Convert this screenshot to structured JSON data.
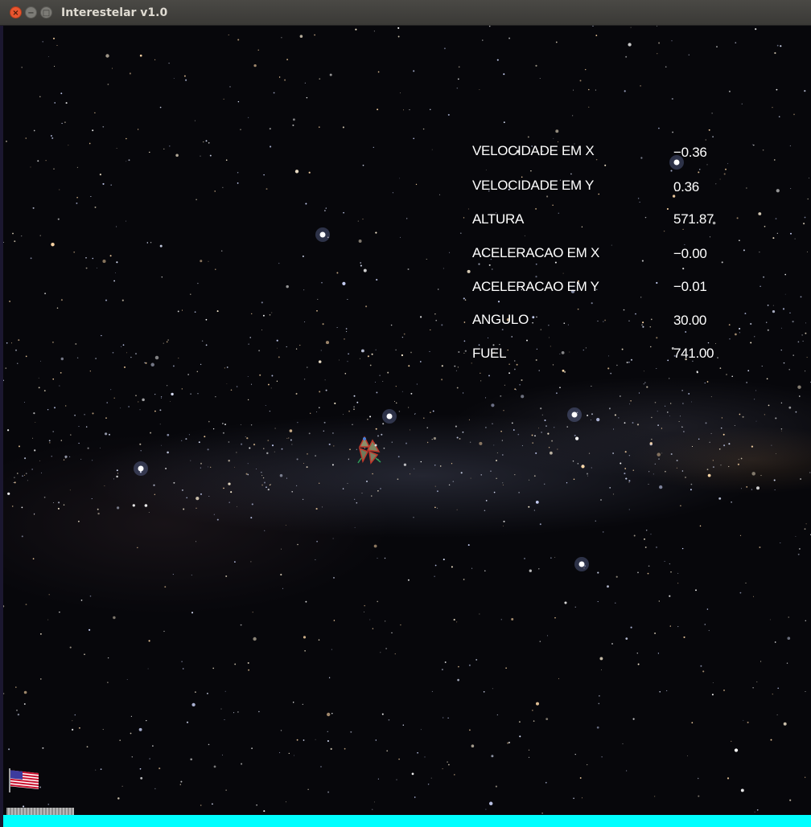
{
  "window": {
    "title": "Interestelar v1.0",
    "close_glyph": "×",
    "min_glyph": "−",
    "max_glyph": "□"
  },
  "hud": [
    {
      "label": "VELOCIDADE EM X",
      "value": "−0.36"
    },
    {
      "label": "VELOCIDADE EM Y",
      "value": "0.36"
    },
    {
      "label": "ALTURA",
      "value": "571.87"
    },
    {
      "label": "ACELERACAO EM X",
      "value": "−0.00"
    },
    {
      "label": "ACELERACAO EM Y",
      "value": "−0.01"
    },
    {
      "label": "ANGULO",
      "value": "30.00"
    },
    {
      "label": "FUEL",
      "value": "741.00"
    }
  ],
  "colors": {
    "ground": "#00ffff",
    "hud_text": "#ffffff",
    "sky": "#07070b"
  },
  "icons": {
    "ship": "lander-ship-icon",
    "flag": "us-flag-icon"
  }
}
